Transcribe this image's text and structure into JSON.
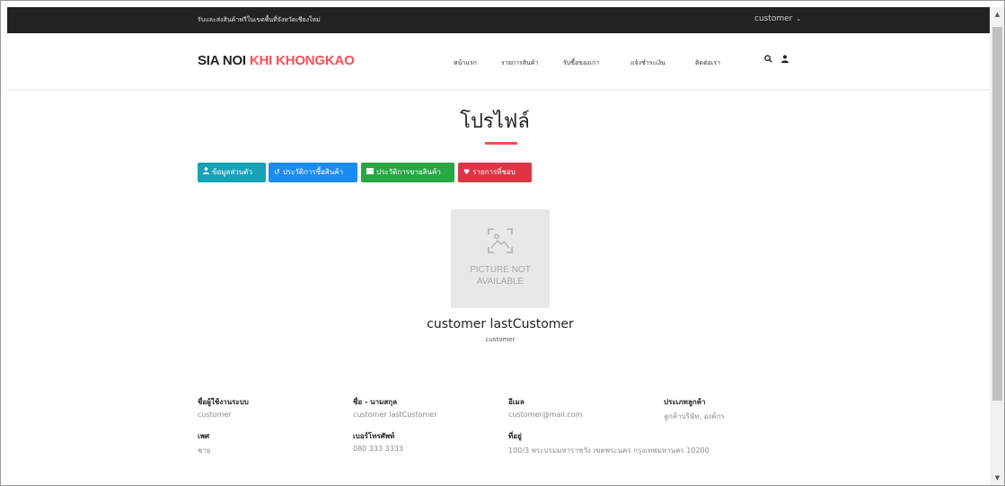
{
  "topbar": {
    "notice": "รับและส่งสินค้าฟรีในเขตพื้นที่จังหวัดเชียงใหม่",
    "user_menu": "customer",
    "user_menu_icon": "chevron-down-icon"
  },
  "header": {
    "logo_part1": "SIA NOI",
    "logo_part2": "KHI KHONGKAO",
    "accent_color": "#ff4d55",
    "nav": [
      "หน้าแรก",
      "รายการสินค้า",
      "รับซื้อของเก่า",
      "แจ้งชำระเงิน",
      "ติดต่อเรา"
    ]
  },
  "profile": {
    "title": "โปรไฟล์",
    "tabs": [
      {
        "label": "ข้อมูลส่วนตัว",
        "icon": "user-icon",
        "color": "#17a2b8"
      },
      {
        "label": "ประวัติการซื้อสินค้า",
        "icon": "history-icon",
        "color": "#1a8cf0"
      },
      {
        "label": "ประวัติการขายสินค้า",
        "icon": "list-icon",
        "color": "#28a745"
      },
      {
        "label": "รายการที่ชอบ",
        "icon": "heart-icon",
        "color": "#dc3545"
      }
    ],
    "avatar_text_line1": "PICTURE NOT",
    "avatar_text_line2": "AVAILABLE",
    "full_name": "customer lastCustomer",
    "username": "customer"
  },
  "details": {
    "username_label": "ชื่อผู้ใช้งานระบบ",
    "username_value": "customer",
    "name_label": "ชื่อ - นามสกุล",
    "name_value": "customer lastCustomer",
    "email_label": "อีเมล",
    "email_value": "customer@mail.com",
    "type_label": "ประเภทลูกค้า",
    "type_value": "ลูกค้าบริษัท, องค์กร",
    "gender_label": "เพศ",
    "gender_value": "ชาย",
    "phone_label": "เบอร์โทรศัพท์",
    "phone_value": "080 333 3333",
    "address_label": "ที่อยู่",
    "address_value": "100/3 พระบรมมหาราชวัง เขตพระนคร กรุงเทพมหานคร 10200"
  }
}
